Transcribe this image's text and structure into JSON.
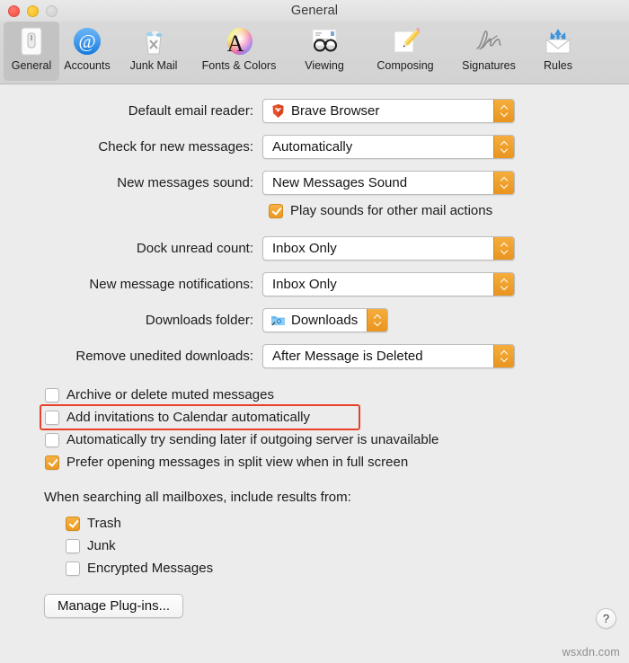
{
  "window": {
    "title": "General",
    "traffic_lights": [
      "close",
      "minimize",
      "zoom"
    ]
  },
  "toolbar": {
    "items": [
      {
        "label": "General",
        "icon": "general-switch-icon",
        "selected": true
      },
      {
        "label": "Accounts",
        "icon": "at-sign-icon",
        "selected": false
      },
      {
        "label": "Junk Mail",
        "icon": "trash-bin-icon",
        "selected": false
      },
      {
        "label": "Fonts & Colors",
        "icon": "color-wheel-a-icon",
        "selected": false
      },
      {
        "label": "Viewing",
        "icon": "eyeglasses-icon",
        "selected": false
      },
      {
        "label": "Composing",
        "icon": "pencil-paper-icon",
        "selected": false
      },
      {
        "label": "Signatures",
        "icon": "signature-icon",
        "selected": false
      },
      {
        "label": "Rules",
        "icon": "envelope-arrows-icon",
        "selected": false
      }
    ]
  },
  "settings": {
    "default_email_reader": {
      "label": "Default email reader:",
      "value": "Brave Browser",
      "icon": "brave-lion-icon"
    },
    "check_for_new_messages": {
      "label": "Check for new messages:",
      "value": "Automatically"
    },
    "new_messages_sound": {
      "label": "New messages sound:",
      "value": "New Messages Sound"
    },
    "play_sounds": {
      "label": "Play sounds for other mail actions",
      "checked": true
    },
    "dock_unread_count": {
      "label": "Dock unread count:",
      "value": "Inbox Only"
    },
    "new_message_notifications": {
      "label": "New message notifications:",
      "value": "Inbox Only"
    },
    "downloads_folder": {
      "label": "Downloads folder:",
      "value": "Downloads",
      "icon": "blue-folder-icon"
    },
    "remove_unedited_downloads": {
      "label": "Remove unedited downloads:",
      "value": "After Message is Deleted"
    }
  },
  "checkboxes": [
    {
      "label": "Archive or delete muted messages",
      "checked": false,
      "highlighted": false
    },
    {
      "label": "Add invitations to Calendar automatically",
      "checked": false,
      "highlighted": true
    },
    {
      "label": "Automatically try sending later if outgoing server is unavailable",
      "checked": false,
      "highlighted": false
    },
    {
      "label": "Prefer opening messages in split view when in full screen",
      "checked": true,
      "highlighted": false
    }
  ],
  "search_section": {
    "heading": "When searching all mailboxes, include results from:",
    "options": [
      {
        "label": "Trash",
        "checked": true
      },
      {
        "label": "Junk",
        "checked": false
      },
      {
        "label": "Encrypted Messages",
        "checked": false
      }
    ]
  },
  "footer": {
    "manage_plugins_label": "Manage Plug-ins...",
    "help_label": "?",
    "watermark": "wsxdn.com"
  },
  "colors": {
    "accent": "#ea9a23",
    "highlight": "#e8412a",
    "background": "#ececec",
    "toolbar": "#d5d5d5"
  }
}
